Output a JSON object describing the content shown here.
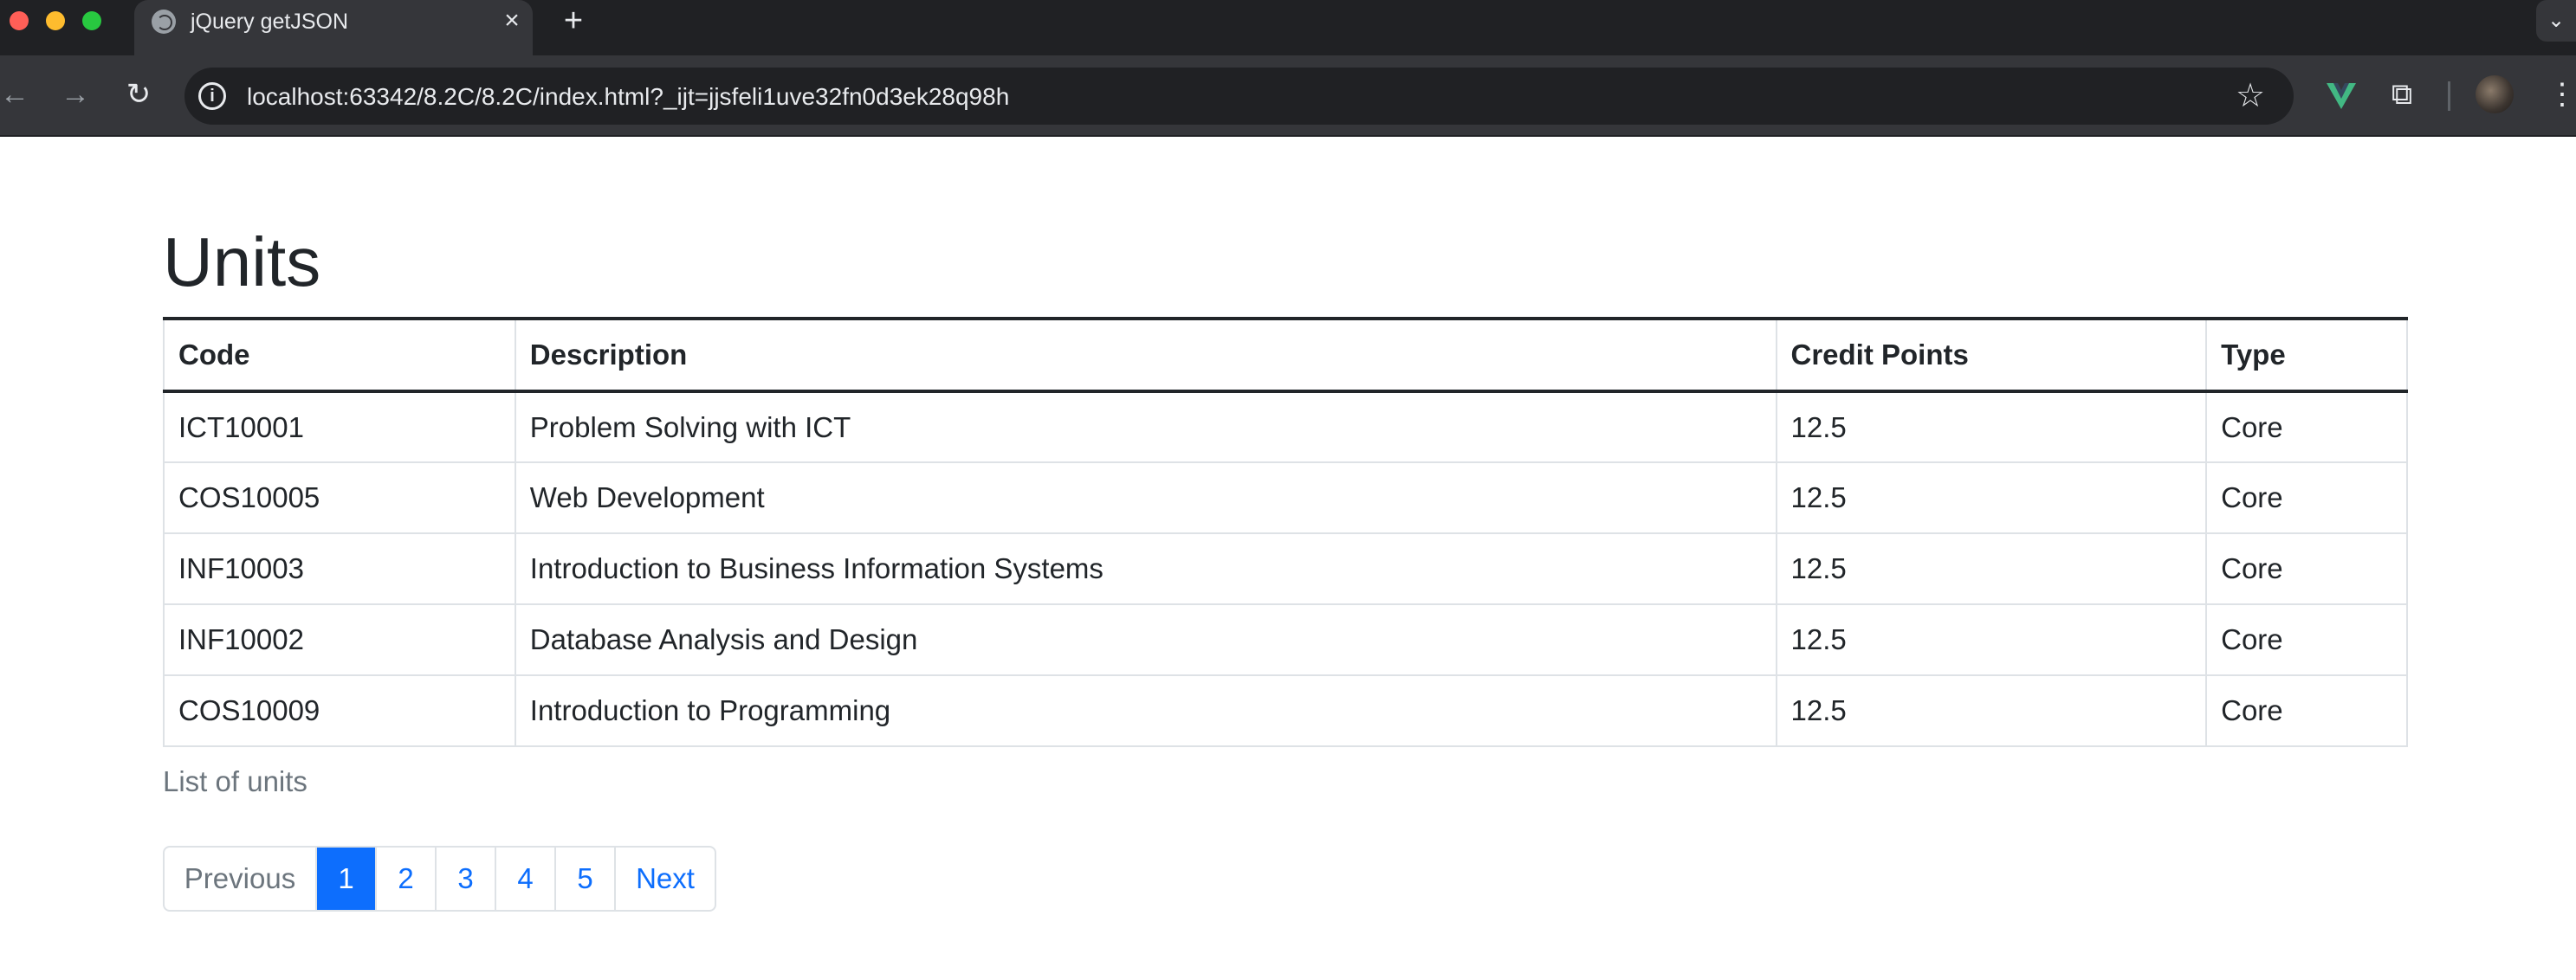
{
  "browser": {
    "tab_title": "jQuery getJSON",
    "tab_close": "×",
    "new_tab": "+",
    "tabs_menu": "⌄",
    "url": "localhost:63342/8.2C/8.2C/index.html?_ijt=jjsfeli1uve32fn0d3ek28q98h",
    "icons": {
      "back": "←",
      "forward": "→",
      "reload": "↻",
      "info": "i",
      "star": "☆",
      "extensions": "⧉",
      "menu": "⋮"
    }
  },
  "page": {
    "heading": "Units",
    "table": {
      "headers": {
        "code": "Code",
        "description": "Description",
        "credit_points": "Credit Points",
        "type": "Type"
      },
      "rows": [
        {
          "code": "ICT10001",
          "description": "Problem Solving with ICT",
          "credit_points": "12.5",
          "type": "Core"
        },
        {
          "code": "COS10005",
          "description": "Web Development",
          "credit_points": "12.5",
          "type": "Core"
        },
        {
          "code": "INF10003",
          "description": "Introduction to Business Information Systems",
          "credit_points": "12.5",
          "type": "Core"
        },
        {
          "code": "INF10002",
          "description": "Database Analysis and Design",
          "credit_points": "12.5",
          "type": "Core"
        },
        {
          "code": "COS10009",
          "description": "Introduction to Programming",
          "credit_points": "12.5",
          "type": "Core"
        }
      ]
    },
    "caption": "List of units",
    "pagination": {
      "previous": "Previous",
      "pages": [
        "1",
        "2",
        "3",
        "4",
        "5"
      ],
      "active_page": "1",
      "next": "Next"
    }
  },
  "colors": {
    "accent": "#0d6efd",
    "text": "#212529",
    "muted": "#6c757d",
    "vue_green": "#42b883"
  }
}
